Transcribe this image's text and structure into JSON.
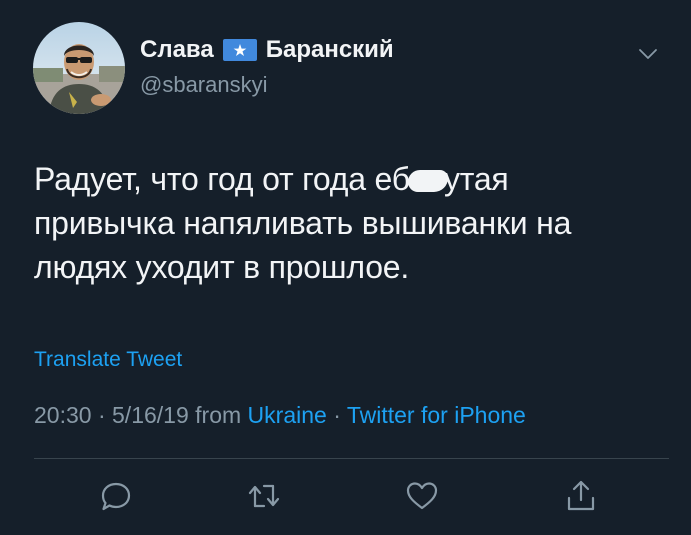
{
  "tweet": {
    "display_name_first": "Слава",
    "display_name_last": "Баранский",
    "handle": "@sbaranskyi",
    "text_line1_before": "Радует, что год от года еб",
    "text_line1_after": "утая",
    "text_line2": "привычка напяливать вышиванки на",
    "text_line3": "людях уходит в прошлое.",
    "translate_label": "Translate Tweet",
    "time": "20:30",
    "date": "5/16/19",
    "from_label": "from",
    "location": "Ukraine",
    "source": "Twitter for iPhone",
    "separator": "·"
  },
  "icons": {
    "flag": "somalia-flag-icon",
    "caret": "chevron-down-icon",
    "reply": "reply-icon",
    "retweet": "retweet-icon",
    "like": "heart-icon",
    "share": "share-icon"
  },
  "colors": {
    "background": "#151f2a",
    "text": "#f2f4f6",
    "secondary": "#8899a6",
    "link": "#1da1f2",
    "divider": "#38444d",
    "flag_blue": "#4189dd"
  }
}
